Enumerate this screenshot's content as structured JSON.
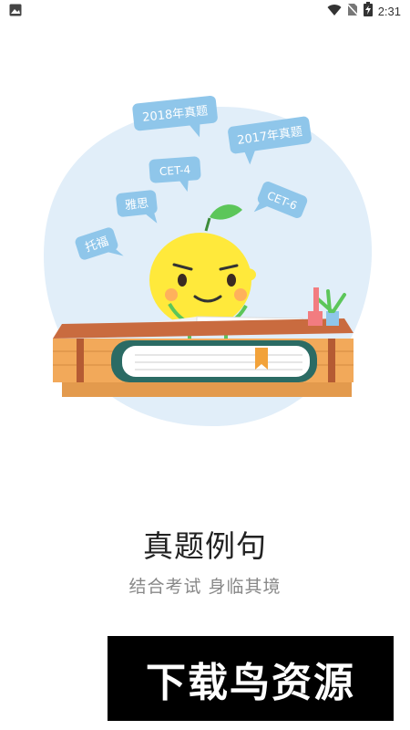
{
  "status_bar": {
    "time": "2:31",
    "icons": [
      "image-icon",
      "wifi-icon",
      "no-sim-icon",
      "battery-icon"
    ]
  },
  "illustration": {
    "bubbles": [
      "2018年真题",
      "2017年真题",
      "CET-4",
      "CET-6",
      "雅思",
      "托福"
    ],
    "colors": {
      "backdrop": "#e1eef9",
      "bubble": "#8fc6ea",
      "lemon": "#ffe93b",
      "leaf": "#5cc65a",
      "book": "#2b6b64",
      "desk": "#c96b3f"
    }
  },
  "page": {
    "title": "真题例句",
    "subtitle": "结合考试 身临其境"
  },
  "watermark": {
    "text": "下载鸟资源"
  }
}
